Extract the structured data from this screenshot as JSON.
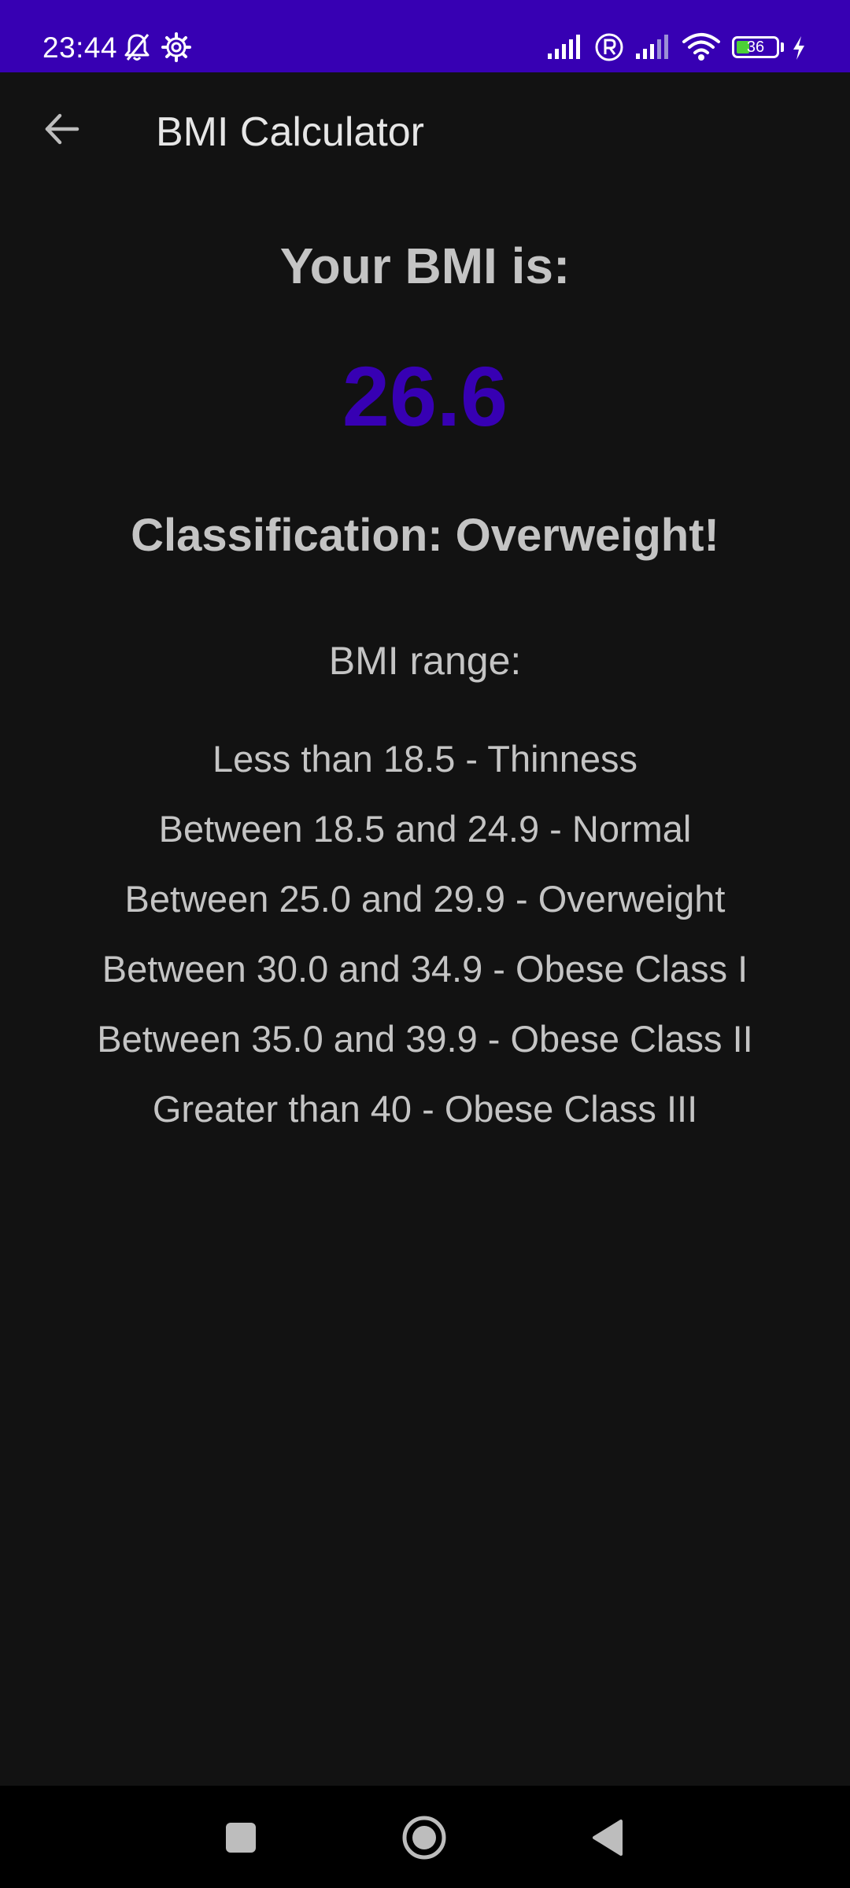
{
  "status_bar": {
    "time": "23:44",
    "battery_level": "36",
    "icons": [
      "notifications-off-icon",
      "settings-gear-icon",
      "signal-icon",
      "roaming-icon",
      "signal-icon",
      "wifi-icon",
      "battery-icon",
      "charging-icon"
    ],
    "background_color": "#3700b3"
  },
  "app_bar": {
    "title": "BMI Calculator",
    "back_icon": "arrow-back-icon"
  },
  "result": {
    "heading": "Your BMI is:",
    "value": "26.6",
    "value_color": "#3700b3",
    "classification": "Classification: Overweight!"
  },
  "ranges": {
    "heading": "BMI range:",
    "items": [
      "Less than 18.5 - Thinness",
      "Between 18.5 and 24.9 - Normal",
      "Between 25.0 and 29.9 - Overweight",
      "Between 30.0 and 34.9 - Obese Class I",
      "Between 35.0 and 39.9 - Obese Class II",
      "Greater than 40 - Obese Class III"
    ]
  },
  "nav_bar": {
    "icons": [
      "recent-apps-icon",
      "home-icon",
      "back-triangle-icon"
    ]
  }
}
